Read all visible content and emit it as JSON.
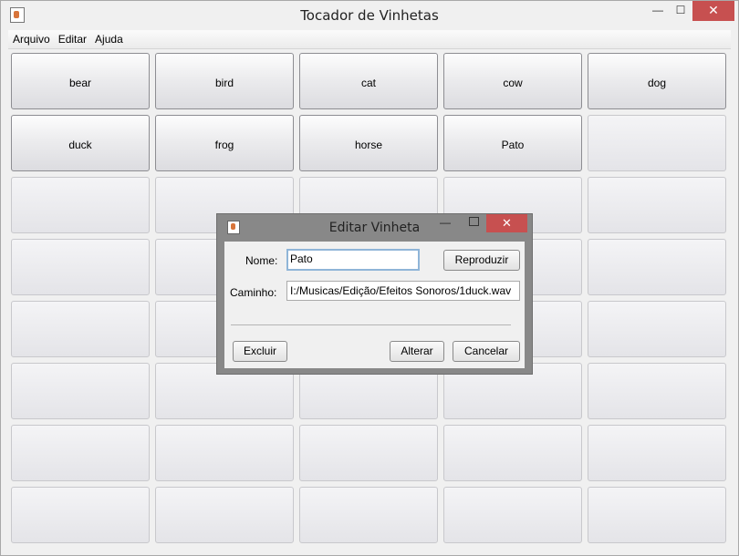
{
  "window": {
    "title": "Tocador de Vinhetas",
    "minimize": "—",
    "maximize": "☐",
    "close": "✕"
  },
  "menu": [
    "Arquivo",
    "Editar",
    "Ajuda"
  ],
  "buttons": [
    {
      "label": "bear"
    },
    {
      "label": "bird"
    },
    {
      "label": "cat"
    },
    {
      "label": "cow"
    },
    {
      "label": "dog"
    },
    {
      "label": "duck"
    },
    {
      "label": "frog"
    },
    {
      "label": "horse"
    },
    {
      "label": "Pato"
    },
    {
      "label": ""
    },
    {
      "label": ""
    },
    {
      "label": ""
    },
    {
      "label": ""
    },
    {
      "label": ""
    },
    {
      "label": ""
    },
    {
      "label": ""
    },
    {
      "label": ""
    },
    {
      "label": ""
    },
    {
      "label": ""
    },
    {
      "label": ""
    },
    {
      "label": ""
    },
    {
      "label": ""
    },
    {
      "label": ""
    },
    {
      "label": ""
    },
    {
      "label": ""
    },
    {
      "label": ""
    },
    {
      "label": ""
    },
    {
      "label": ""
    },
    {
      "label": ""
    },
    {
      "label": ""
    },
    {
      "label": ""
    },
    {
      "label": ""
    },
    {
      "label": ""
    },
    {
      "label": ""
    },
    {
      "label": ""
    },
    {
      "label": ""
    },
    {
      "label": ""
    },
    {
      "label": ""
    },
    {
      "label": ""
    },
    {
      "label": ""
    }
  ],
  "dialog": {
    "title": "Editar Vinheta",
    "minimize": "—",
    "close": "✕",
    "name_label": "Nome:",
    "name_value": "Pato",
    "path_label": "Caminho:",
    "path_value": "I:/Musicas/Edição/Efeitos Sonoros/1duck.wav",
    "play_label": "Reproduzir",
    "delete_label": "Excluir",
    "update_label": "Alterar",
    "cancel_label": "Cancelar"
  }
}
